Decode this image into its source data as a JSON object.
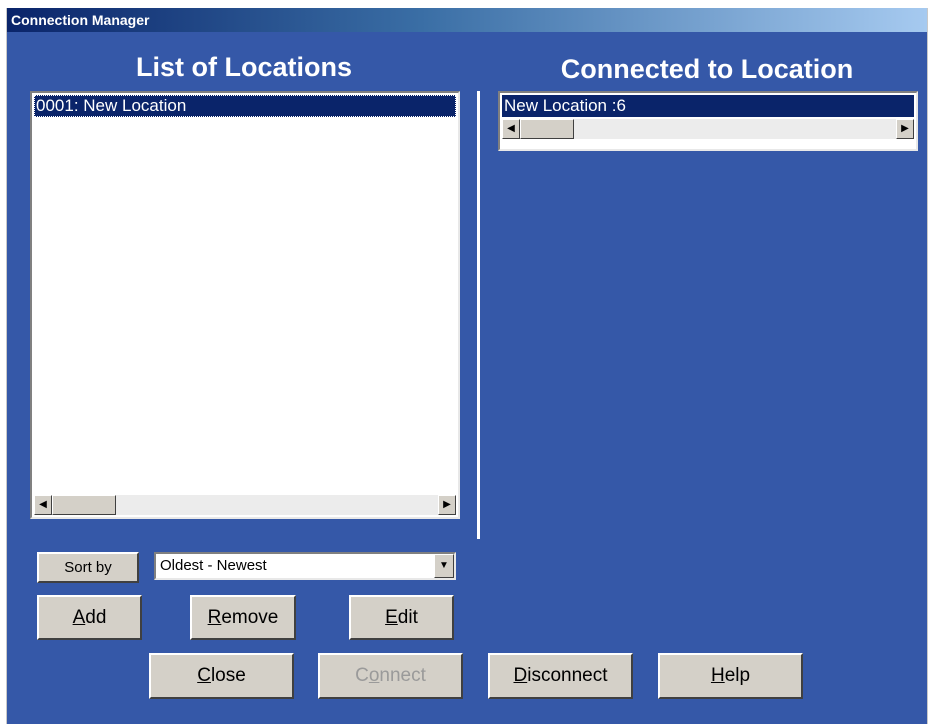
{
  "window": {
    "title": "Connection Manager"
  },
  "locations": {
    "heading": "List of Locations",
    "items": [
      {
        "label": "0001: New Location"
      }
    ]
  },
  "connected": {
    "heading": "Connected to Location",
    "items": [
      {
        "label": "New Location  :6"
      }
    ]
  },
  "sort": {
    "button_label": "Sort by",
    "selected": "Oldest - Newest"
  },
  "buttons": {
    "add": {
      "mnemonic": "A",
      "rest": "dd"
    },
    "remove": {
      "mnemonic": "R",
      "rest": "emove"
    },
    "edit": {
      "mnemonic": "E",
      "rest": "dit"
    },
    "close": {
      "mnemonic": "C",
      "rest": "lose"
    },
    "connect": {
      "pre": "C",
      "mnemonic": "o",
      "rest": "nnect",
      "enabled": false
    },
    "disconnect": {
      "mnemonic": "D",
      "rest": "isconnect"
    },
    "help": {
      "mnemonic": "H",
      "rest": "elp"
    }
  },
  "icons": {
    "scroll_left": "arrow-left-icon",
    "scroll_right": "arrow-right-icon",
    "dropdown": "chevron-down-icon"
  },
  "colors": {
    "window_bg": "#3558a8",
    "selection": "#0a246a",
    "button_face": "#d4d0c8"
  }
}
